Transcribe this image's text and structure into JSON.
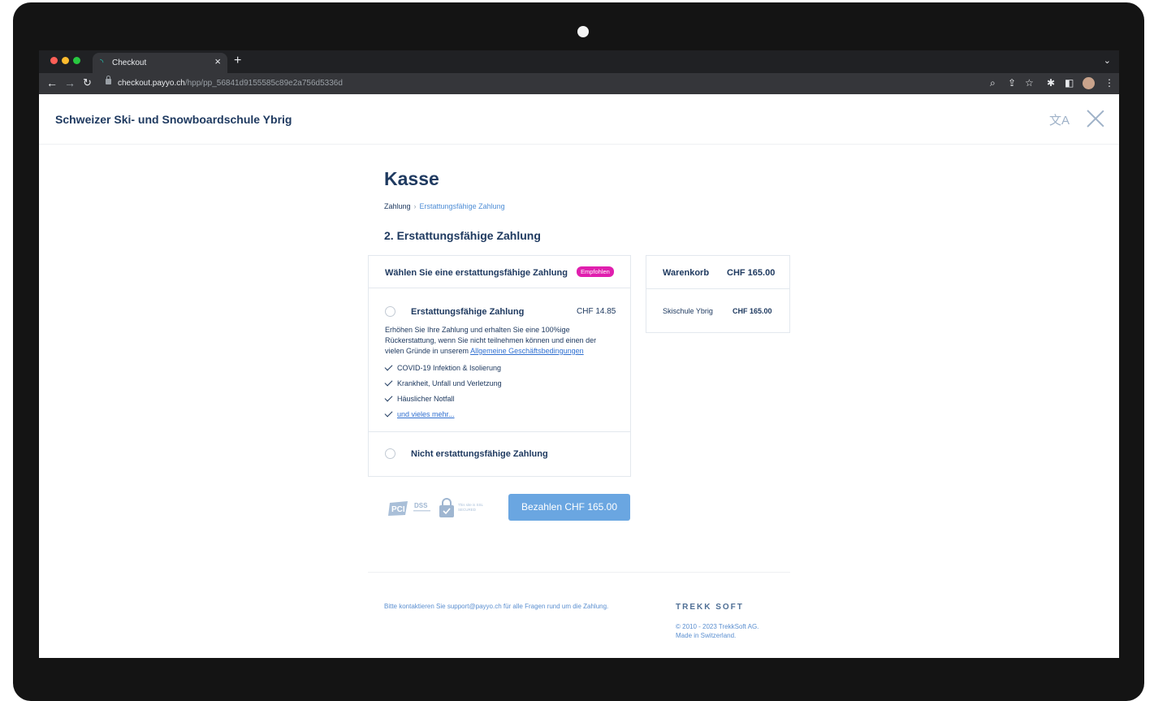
{
  "browser": {
    "tab_title": "Checkout",
    "url_domain": "checkout.payyo.ch",
    "url_path": "/hpp/pp_56841d9155585c89e2a756d5336d"
  },
  "header": {
    "merchant_name": "Schweizer Ski- und Snowboardschule Ybrig"
  },
  "checkout": {
    "title": "Kasse",
    "breadcrumb": [
      "Zahlung",
      "›",
      "Erstattungsfähige Zahlung"
    ],
    "step_title": "2. Erstattungsfähige Zahlung"
  },
  "payment_card": {
    "heading": "Wählen Sie eine erstattungsfähige Zahlung",
    "badge": "Empfohlen",
    "refundable": {
      "label": "Erstattungsfähige Zahlung",
      "price": "CHF 14.85",
      "description": "Erhöhen Sie Ihre Zahlung und erhalten Sie eine 100%ige Rückerstattung, wenn Sie nicht teilnehmen können und einen der vielen Gründe in unserem",
      "terms_link": "Allgemeine Geschäftsbedingungen",
      "features": [
        "COVID-19 Infektion & Isolierung",
        "Krankheit, Unfall und Verletzung",
        "Häuslicher Notfall"
      ],
      "more_link": "und vieles mehr..."
    },
    "non_refundable": {
      "label": "Nicht erstattungsfähige Zahlung"
    }
  },
  "cart": {
    "title": "Warenkorb",
    "total": "CHF 165.00",
    "items": [
      {
        "name": "Skischule Ybrig",
        "price": "CHF 165.00"
      }
    ]
  },
  "badges": {
    "pci": "PCI DSS",
    "ssl": "This site is SSL SECURED"
  },
  "pay_button": "Bezahlen CHF 165.00",
  "footer": {
    "support_text": "Bitte kontaktieren Sie support@payyo.ch für alle Fragen rund um die Zahlung.",
    "brand": "TREKK SOFT",
    "copyright": "© 2010 - 2023 TrekkSoft AG.",
    "made_in": "Made in Switzerland."
  }
}
